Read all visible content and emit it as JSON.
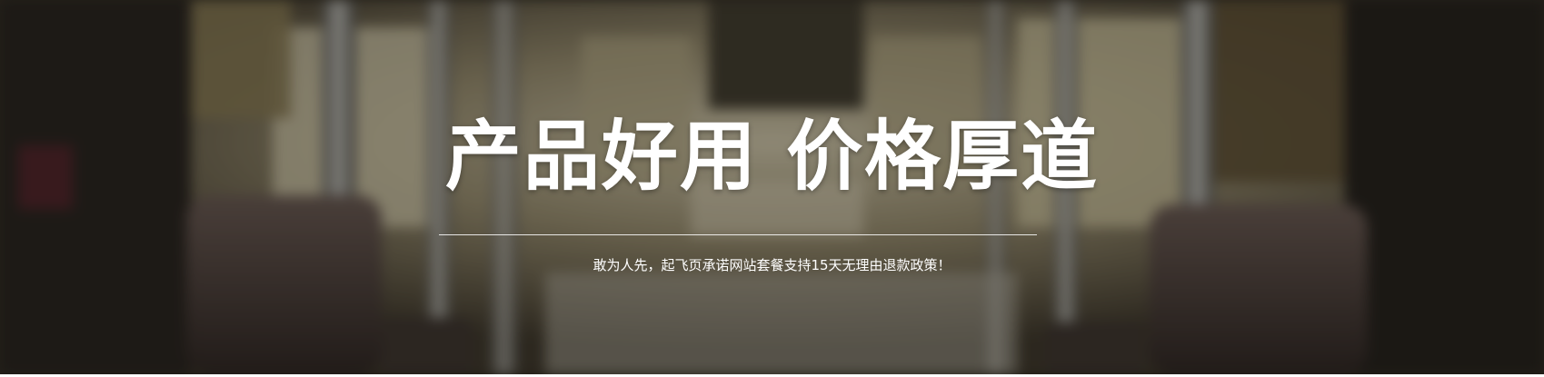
{
  "banner": {
    "headline": "产品好用 价格厚道",
    "subtitle": "敢为人先，起飞页承诺网站套餐支持15天无理由退款政策！"
  },
  "colors": {
    "text": "#ffffff",
    "overlay": "#14120e",
    "divider": "#ffffff"
  }
}
